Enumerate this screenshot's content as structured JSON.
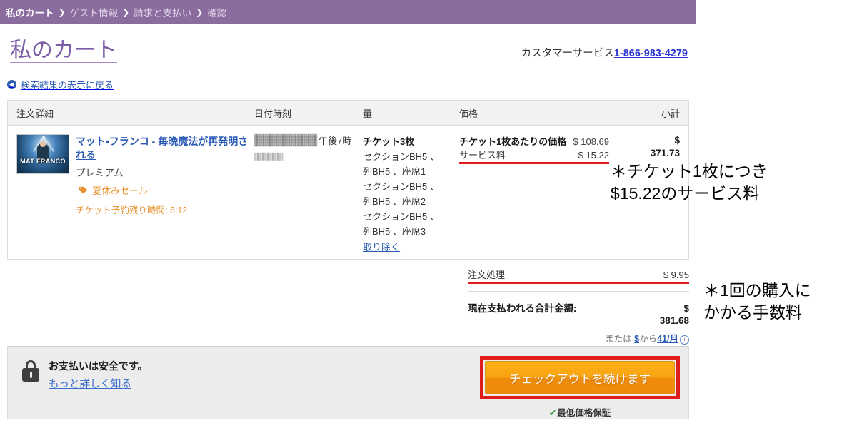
{
  "breadcrumb": {
    "separator": "❯",
    "items": [
      {
        "label": "私のカート",
        "active": true
      },
      {
        "label": "ゲスト情報",
        "active": false
      },
      {
        "label": "請求と支払い",
        "active": false
      },
      {
        "label": "確認",
        "active": false
      }
    ]
  },
  "header": {
    "page_title": "私のカート",
    "customer_service_label": "カスタマーサービス",
    "customer_service_phone": "1-866-983-4279",
    "back_link": "検索結果の表示に戻る",
    "back_icon": "circle-left-arrow-icon"
  },
  "table": {
    "columns": {
      "detail": "注文詳細",
      "date": "日付時刻",
      "quantity": "量",
      "price": "価格",
      "subtotal": "小計"
    },
    "item": {
      "thumbnail_text": "MAT FRANCO",
      "thumbnail_alt": "event-thumbnail",
      "title": "マット・フランコ - 毎晩魔法が再発明される",
      "tier": "プレミアム",
      "promo_icon": "tag-icon",
      "promo_label": "夏休みセール",
      "hold_timer": "チケット予約残り時間: 8:12",
      "date_redacted": true,
      "date_time": "午後7時",
      "quantity_heading": "チケット3枚",
      "seat_lines": [
        "セクションBH5 、",
        "列BH5 、座席1",
        "セクションBH5 、",
        "列BH5 、座席2",
        "セクションBH5 、",
        "列BH5 、座席3"
      ],
      "remove_label": "取り除く",
      "price_per_ticket_label": "チケット1枚あたりの価格",
      "price_per_ticket_value": "$ 108.69",
      "service_fee_label": "サービス料",
      "service_fee_value": "$ 15.22",
      "subtotal_currency": "$",
      "subtotal_value": "371.73"
    },
    "order_processing_label": "注文処理",
    "order_processing_value": "$ 9.95",
    "total_label": "現在支払われる合計金額:",
    "total_currency": "$",
    "total_value": "381.68",
    "financing_prefix": "または",
    "financing_amount": "$",
    "financing_middle": "から",
    "financing_term": "41/月",
    "financing_info_icon": "info-circle-icon"
  },
  "footer": {
    "lock_icon": "lock-icon",
    "secure_title": "お支払いは安全です。",
    "secure_link": "もっと詳しく知る",
    "checkout_button": "チェックアウトを続けます",
    "guarantee_icon": "check-icon",
    "guarantee_label": "最低価格保証"
  },
  "annotations": {
    "service_fee_note": "＊チケット1枚につき\n$15.22のサービス料",
    "processing_note": "＊1回の購入に\nかかる手数料"
  },
  "colors": {
    "breadcrumb_bar": "#8a6d9e",
    "title_purple": "#7b5ea7",
    "link_blue": "#2b5bb5",
    "promo_orange": "#e8922e",
    "annotation_red": "#e01b1b",
    "checkout_orange": "#f9a412",
    "guarantee_green": "#2b9b3e"
  }
}
